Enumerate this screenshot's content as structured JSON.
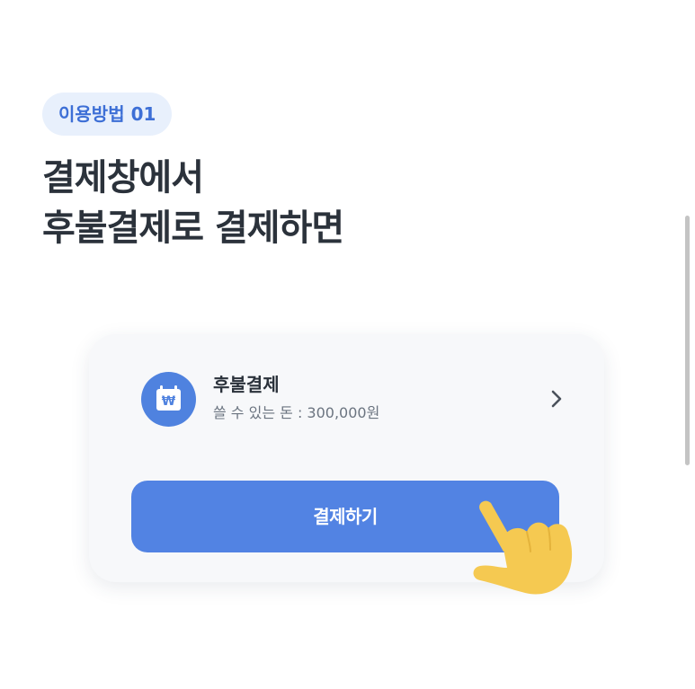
{
  "step_badge": "이용방법 01",
  "headline": {
    "line1": "결제창에서",
    "line2": "후불결제로 결제하면"
  },
  "payment_method": {
    "icon": "won-wallet-icon",
    "title": "후불결제",
    "subtitle": "쓸 수 있는 돈 : 300,000원"
  },
  "pay_button_label": "결제하기",
  "colors": {
    "accent": "#5283e3",
    "badge_bg": "#e8f0fc",
    "badge_text": "#3d6fd6",
    "heading_text": "#2b323b",
    "hand": "#f5c951"
  }
}
